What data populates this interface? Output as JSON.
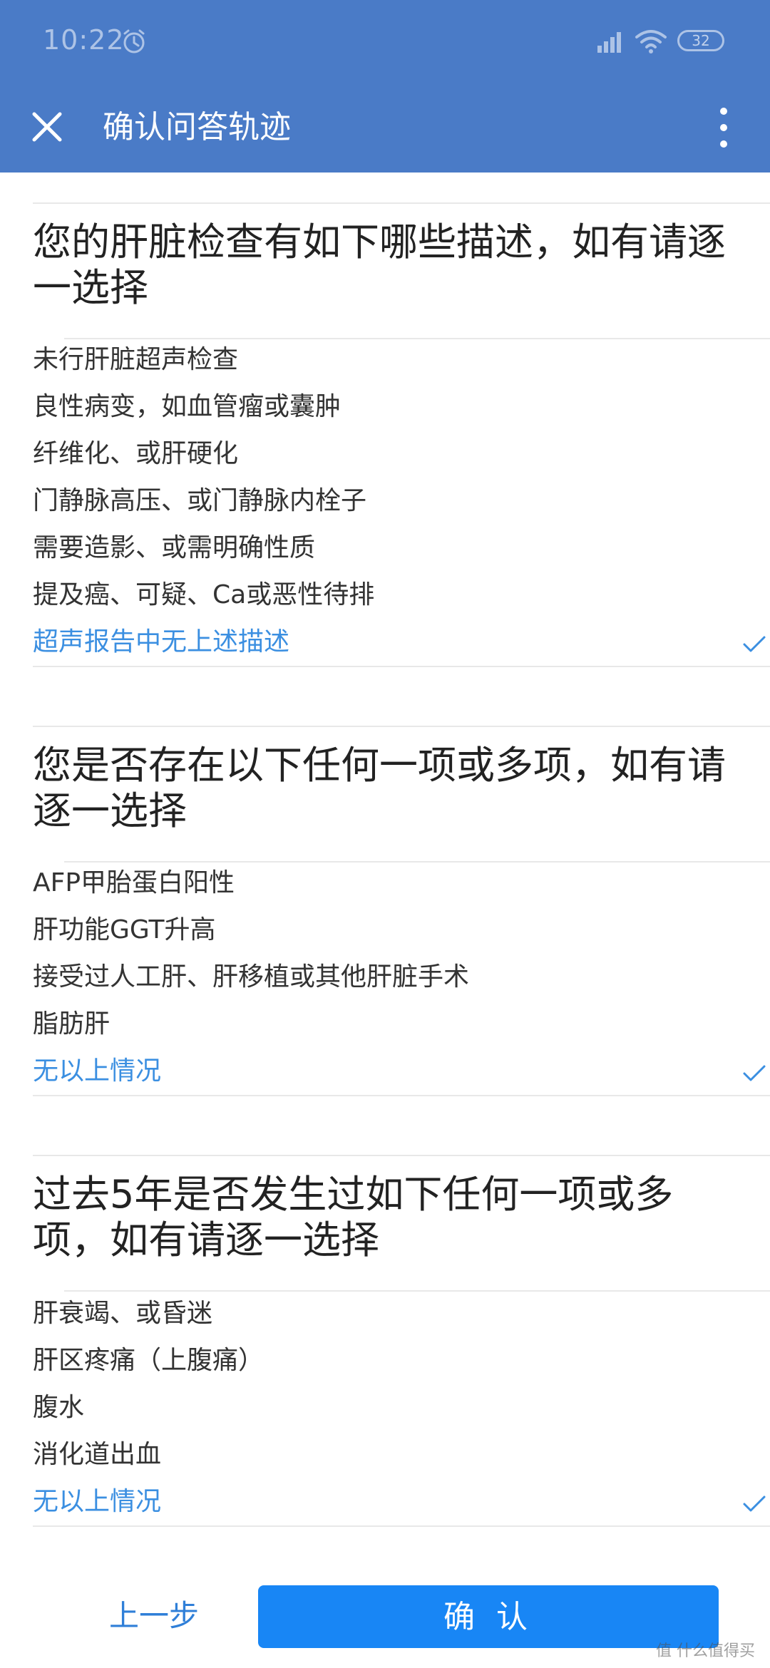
{
  "status_bar": {
    "time": "10:22",
    "battery": "32"
  },
  "toolbar": {
    "title": "确认问答轨迹"
  },
  "questions": [
    {
      "title": "您的肝脏检查有如下哪些描述，如有请逐一选择",
      "options": [
        {
          "label": "未行肝脏超声检查",
          "selected": false
        },
        {
          "label": "良性病变，如血管瘤或囊肿",
          "selected": false
        },
        {
          "label": "纤维化、或肝硬化",
          "selected": false
        },
        {
          "label": "门静脉高压、或门静脉内栓子",
          "selected": false
        },
        {
          "label": "需要造影、或需明确性质",
          "selected": false
        },
        {
          "label": "提及癌、可疑、Ca或恶性待排",
          "selected": false
        },
        {
          "label": "超声报告中无上述描述",
          "selected": true
        }
      ]
    },
    {
      "title": "您是否存在以下任何一项或多项，如有请逐一选择",
      "options": [
        {
          "label": "AFP甲胎蛋白阳性",
          "selected": false
        },
        {
          "label": "肝功能GGT升高",
          "selected": false
        },
        {
          "label": "接受过人工肝、肝移植或其他肝脏手术",
          "selected": false
        },
        {
          "label": "脂肪肝",
          "selected": false
        },
        {
          "label": "无以上情况",
          "selected": true
        }
      ]
    },
    {
      "title": "过去5年是否发生过如下任何一项或多项，如有请逐一选择",
      "options": [
        {
          "label": "肝衰竭、或昏迷",
          "selected": false
        },
        {
          "label": "肝区疼痛（上腹痛）",
          "selected": false
        },
        {
          "label": "腹水",
          "selected": false
        },
        {
          "label": "消化道出血",
          "selected": false
        },
        {
          "label": "无以上情况",
          "selected": true
        }
      ]
    }
  ],
  "footer": {
    "prev_label": "上一步",
    "confirm_label": "确 认"
  },
  "watermark": "值 什么值得买",
  "colors": {
    "header": "#4a7bc7",
    "accent": "#1886f5",
    "selected": "#3b8fe1"
  }
}
